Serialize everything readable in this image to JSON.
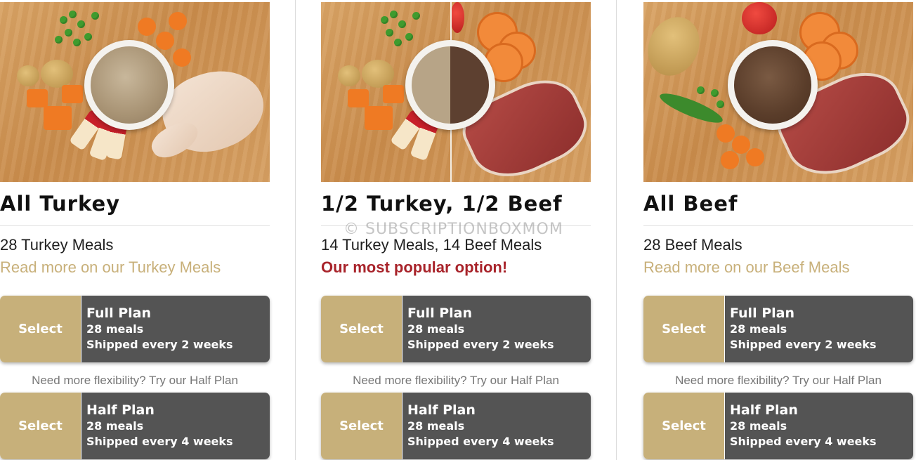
{
  "watermark": "© SUBSCRIPTIONBOXMOM",
  "colors": {
    "select_bg": "#c7b07a",
    "plan_bg": "#545454",
    "link": "#c8b07a",
    "popular": "#a8232a"
  },
  "cards": [
    {
      "image": "turkey-meal-photo",
      "title": "All Turkey",
      "meals": "28 Turkey Meals",
      "subtext": "Read more on our Turkey Meals",
      "full_plan": {
        "select": "Select",
        "name": "Full Plan",
        "count": "28 meals",
        "ship": "Shipped every 2 weeks"
      },
      "flex_note": "Need more flexibility? Try our Half Plan",
      "half_plan": {
        "select": "Select",
        "name": "Half Plan",
        "count": "28 meals",
        "ship": "Shipped every 4 weeks"
      }
    },
    {
      "image": "turkey-beef-meal-photo",
      "title": "1/2 Turkey, 1/2 Beef",
      "meals": "14 Turkey Meals, 14 Beef Meals",
      "subtext": "Our most popular option!",
      "full_plan": {
        "select": "Select",
        "name": "Full Plan",
        "count": "28 meals",
        "ship": "Shipped every 2 weeks"
      },
      "flex_note": "Need more flexibility? Try our Half Plan",
      "half_plan": {
        "select": "Select",
        "name": "Half Plan",
        "count": "28 meals",
        "ship": "Shipped every 4 weeks"
      }
    },
    {
      "image": "beef-meal-photo",
      "title": "All Beef",
      "meals": "28 Beef Meals",
      "subtext": "Read more on our Beef Meals",
      "full_plan": {
        "select": "Select",
        "name": "Full Plan",
        "count": "28 meals",
        "ship": "Shipped every 2 weeks"
      },
      "flex_note": "Need more flexibility? Try our Half Plan",
      "half_plan": {
        "select": "Select",
        "name": "Half Plan",
        "count": "28 meals",
        "ship": "Shipped every 4 weeks"
      }
    }
  ]
}
